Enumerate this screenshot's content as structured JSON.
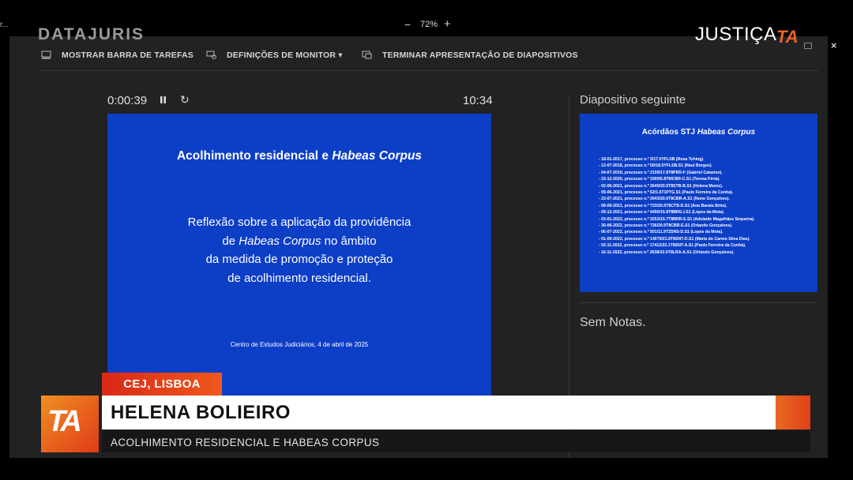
{
  "topbar": {
    "corner_text": "r...",
    "zoom_minus": "−",
    "zoom_level": "72%",
    "zoom_plus": "+",
    "brand_left": "DATAJURIS",
    "brand_right": "JUSTIÇA",
    "brand_right_mark": "TA",
    "close": "×"
  },
  "toolbar": {
    "taskbar_label": "MOSTRAR BARRA DE TAREFAS",
    "monitor_label": "DEFINIÇÕES DE MONITOR ▾",
    "end_label": "TERMINAR APRESENTAÇÃO DE DIAPOSITIVOS"
  },
  "presenter": {
    "timer": "0:00:39",
    "clock": "10:34",
    "next_label": "Diapositivo seguinte",
    "notes": "Sem Notas."
  },
  "current_slide": {
    "title_plain": "Acolhimento residencial e ",
    "title_italic": "Habeas Corpus",
    "body_line1": "Reflexão sobre a aplicação da providência",
    "body_line2_pre": "de ",
    "body_line2_italic": "Habeas Corpus",
    "body_line2_post": " no âmbito",
    "body_line3": "da medida de promoção e proteção",
    "body_line4": "de acolhimento residencial.",
    "footer": "Centro de Estudos Judiciários, 4 de abril de 2025"
  },
  "next_slide": {
    "title_plain": "Acórdãos STJ ",
    "title_italic": "Habeas Corpus",
    "items": [
      "- 18-01-2017, processo n.º 3/17.0YFLSB (Rosa Tching).",
      "- 12-07-2018, processo n.º 50/18.0YFLSB.S1 (Raul Borges).",
      "- 04-07-2019, processo n.º 2159/17.8T8PRD-F (Gabriel Catarino).",
      "- 23-12-2020, processo n.º 330/05.8TMCBR-C.S1 (Teresa Féria).",
      "- 02-06-2021, processo n.º 2640/20.5T8STB-B.S1 (Helena Moniz).",
      "- 09-06-2021, processo n.º 62/1.6T1PTG.S1 (Paulo Ferreira da Cunha).",
      "- 23-07-2021, processo n.º 2943/20.6T8CBR-A.S1 (Nuno Gonçalves).",
      "- 08-09-2021, processo n.º 733/20.5T8CTB-D.S1 (Ana Barata Brito).",
      "- 09-12-2021, processo n.º 4490/15.8T8BRG-I.S1 (Lopes da Mota).",
      "- 03-01-2022, processo n.º 3253/19.7T8BRR-E.S1 (Adelaide Magalhães Sequeira).",
      "- 30-06-2022, processo n.º 736/20.0T8CBR-E.S1 (Orlando Gonçalves).",
      "- 06-07-2022, processo n.º 501/11.9T2SNS-D.S1 (Lopes da Mota).",
      "- 01-09-2022, processo n.º 14079/21.8T8SNT-D.S1 (Maria do Carmo Silva Dias).",
      "- 02-11-2022, processo n.º 17412/22.1T8SNT-A.S1 (Paulo Ferreira da Cunha).",
      "- 16-11-2022, processo n.º 2638/22.6T8LRA-A.S1 (Orlando Gonçalves)."
    ]
  },
  "lower_third": {
    "location": "CEJ, LISBOA",
    "logo": "TA",
    "name": "HELENA BOLIEIRO",
    "subtitle": "ACOLHIMENTO RESIDENCIAL E HABEAS CORPUS"
  },
  "colors": {
    "slide_bg": "#0c3ec6",
    "accent_orange": "#f0581c",
    "accent_red": "#d92818"
  }
}
